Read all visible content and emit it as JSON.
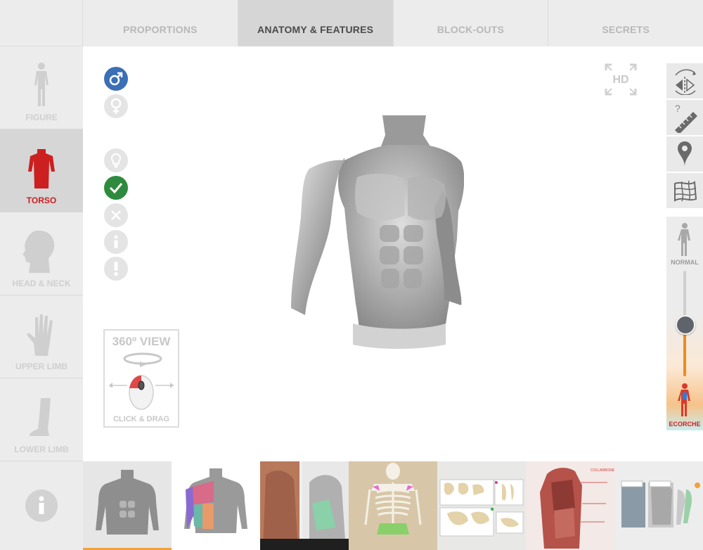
{
  "tabs": [
    {
      "label": "PROPORTIONS",
      "active": false
    },
    {
      "label": "ANATOMY & FEATURES",
      "active": true
    },
    {
      "label": "BLOCK-OUTS",
      "active": false
    },
    {
      "label": "SECRETS",
      "active": false
    }
  ],
  "sidebar": {
    "items": [
      {
        "label": "FIGURE",
        "icon": "figure-icon",
        "active": false
      },
      {
        "label": "TORSO",
        "icon": "torso-icon",
        "active": true
      },
      {
        "label": "HEAD & NECK",
        "icon": "head-icon",
        "active": false
      },
      {
        "label": "UPPER LIMB",
        "icon": "hand-icon",
        "active": false
      },
      {
        "label": "LOWER LIMB",
        "icon": "leg-icon",
        "active": false
      }
    ],
    "info_icon": "info-icon"
  },
  "gender": {
    "male_icon": "male-icon",
    "female_icon": "female-icon",
    "selected": "male"
  },
  "view360": {
    "title": "360º VIEW",
    "hint": "CLICK & DRAG"
  },
  "hd_label": "HD",
  "slider": {
    "top_label": "NORMAL",
    "bottom_label": "ECORCHE",
    "value": 0.5
  },
  "colors": {
    "active_red": "#cc1f1f",
    "male_blue": "#3b6fb6",
    "check_green": "#2e8b3e",
    "slider_orange": "#f08a1e"
  },
  "thumbnails": [
    "torso-sculpt",
    "torso-muscle-map",
    "torso-photo-pose",
    "skeleton",
    "pelvis-bones",
    "back-muscles",
    "back-reference"
  ]
}
